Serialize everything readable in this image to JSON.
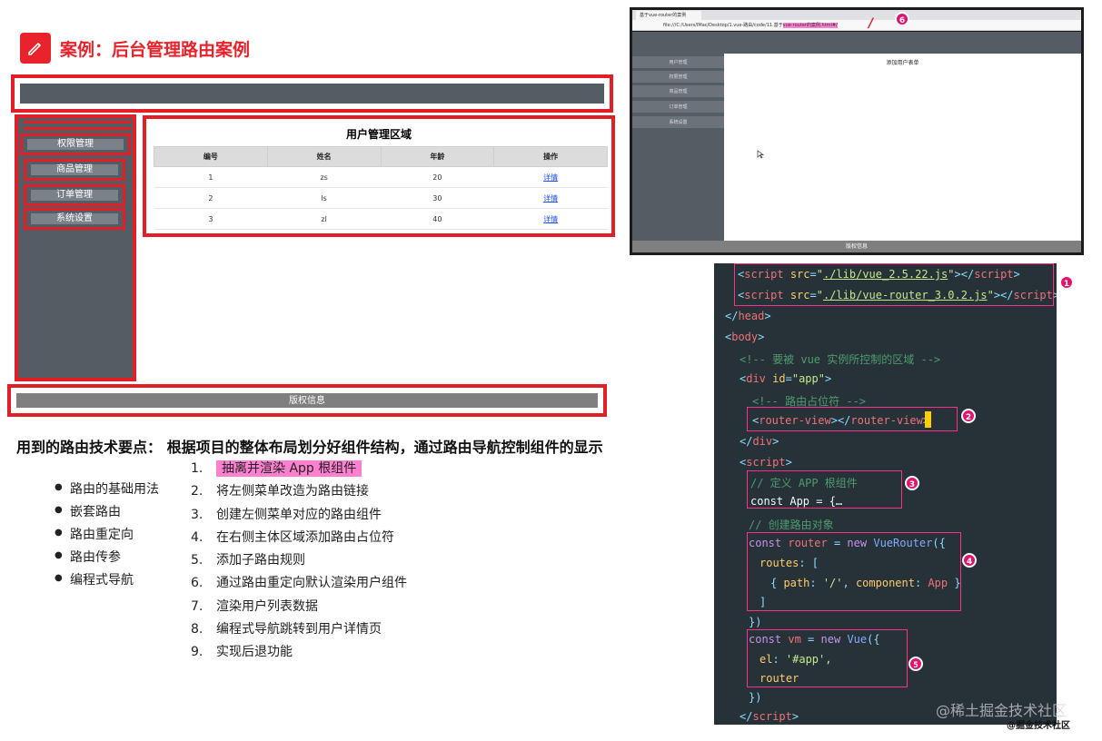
{
  "title": {
    "text": "案例：后台管理路由案例"
  },
  "mock": {
    "sidebar_items": [
      "权限管理",
      "商品管理",
      "订单管理",
      "系统设置"
    ],
    "main_title": "用户管理区域",
    "table_headers": [
      "编号",
      "姓名",
      "年龄",
      "操作"
    ],
    "rows": [
      {
        "id": "1",
        "name": "zs",
        "age": "20",
        "action": "详情"
      },
      {
        "id": "2",
        "name": "ls",
        "age": "30",
        "action": "详情"
      },
      {
        "id": "3",
        "name": "zl",
        "age": "40",
        "action": "详情"
      }
    ],
    "footer": "版权信息"
  },
  "tech_points": {
    "heading": "用到的路由技术要点：",
    "summary": "根据项目的整体布局划分好组件结构，通过路由导航控制组件的显示",
    "bullets": [
      "路由的基础用法",
      "嵌套路由",
      "路由重定向",
      "路由传参",
      "编程式导航"
    ],
    "steps": [
      {
        "num": "1.",
        "text": "抽离并渲染 App 根组件"
      },
      {
        "num": "2.",
        "text": "将左侧菜单改造为路由链接"
      },
      {
        "num": "3.",
        "text": "创建左侧菜单对应的路由组件"
      },
      {
        "num": "4.",
        "text": "在右侧主体区域添加路由占位符"
      },
      {
        "num": "5.",
        "text": "添加子路由规则"
      },
      {
        "num": "6.",
        "text": "通过路由重定向默认渲染用户组件"
      },
      {
        "num": "7.",
        "text": "渲染用户列表数据"
      },
      {
        "num": "8.",
        "text": "编程式导航跳转到用户详情页"
      },
      {
        "num": "9.",
        "text": "实现后退功能"
      }
    ]
  },
  "browser": {
    "tab_title": "基于vue-router的案例",
    "address_prefix": "file:///C:/Users/IMac/Desktop/1.vue-路由/code/11.基于",
    "address_highlight": "vue-router的案例.html#/",
    "slash_mark": "/",
    "badge": "6",
    "sidebar_items": [
      "用户管理",
      "权限管理",
      "商品管理",
      "订单管理",
      "系统设置"
    ],
    "main_title": "添加用户表单",
    "footer": "版权信息"
  },
  "code": {
    "badges": [
      "1",
      "2",
      "3",
      "4",
      "5"
    ],
    "script1_src": "./lib/vue_2.5.22.js",
    "script2_src": "./lib/vue-router_3.0.2.js",
    "comment_area": "<!-- 要被 vue 实例所控制的区域 -->",
    "comment_router": "<!-- 路由占位符 -->",
    "comment_app": "// 定义 APP 根组件",
    "const_app": "const App = {…",
    "comment_router_obj": "// 创建路由对象",
    "el_value": "'#app',"
  },
  "watermark": {
    "main": "@稀土掘金技术社区",
    "sub": "@掘金技术社区"
  },
  "colors": {
    "accent_red": "#e21f26",
    "highlight_pink": "#ff7fd0",
    "sidebar_gray": "#545c64",
    "code_bg": "#263238"
  }
}
